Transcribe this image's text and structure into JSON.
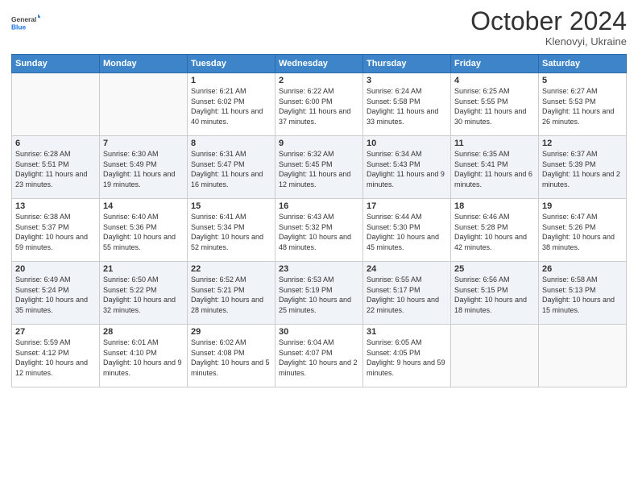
{
  "header": {
    "logo_general": "General",
    "logo_blue": "Blue",
    "month_title": "October 2024",
    "subtitle": "Klenovyi, Ukraine"
  },
  "columns": [
    "Sunday",
    "Monday",
    "Tuesday",
    "Wednesday",
    "Thursday",
    "Friday",
    "Saturday"
  ],
  "weeks": [
    [
      {
        "day": "",
        "info": ""
      },
      {
        "day": "",
        "info": ""
      },
      {
        "day": "1",
        "info": "Sunrise: 6:21 AM\nSunset: 6:02 PM\nDaylight: 11 hours and 40 minutes."
      },
      {
        "day": "2",
        "info": "Sunrise: 6:22 AM\nSunset: 6:00 PM\nDaylight: 11 hours and 37 minutes."
      },
      {
        "day": "3",
        "info": "Sunrise: 6:24 AM\nSunset: 5:58 PM\nDaylight: 11 hours and 33 minutes."
      },
      {
        "day": "4",
        "info": "Sunrise: 6:25 AM\nSunset: 5:55 PM\nDaylight: 11 hours and 30 minutes."
      },
      {
        "day": "5",
        "info": "Sunrise: 6:27 AM\nSunset: 5:53 PM\nDaylight: 11 hours and 26 minutes."
      }
    ],
    [
      {
        "day": "6",
        "info": "Sunrise: 6:28 AM\nSunset: 5:51 PM\nDaylight: 11 hours and 23 minutes."
      },
      {
        "day": "7",
        "info": "Sunrise: 6:30 AM\nSunset: 5:49 PM\nDaylight: 11 hours and 19 minutes."
      },
      {
        "day": "8",
        "info": "Sunrise: 6:31 AM\nSunset: 5:47 PM\nDaylight: 11 hours and 16 minutes."
      },
      {
        "day": "9",
        "info": "Sunrise: 6:32 AM\nSunset: 5:45 PM\nDaylight: 11 hours and 12 minutes."
      },
      {
        "day": "10",
        "info": "Sunrise: 6:34 AM\nSunset: 5:43 PM\nDaylight: 11 hours and 9 minutes."
      },
      {
        "day": "11",
        "info": "Sunrise: 6:35 AM\nSunset: 5:41 PM\nDaylight: 11 hours and 6 minutes."
      },
      {
        "day": "12",
        "info": "Sunrise: 6:37 AM\nSunset: 5:39 PM\nDaylight: 11 hours and 2 minutes."
      }
    ],
    [
      {
        "day": "13",
        "info": "Sunrise: 6:38 AM\nSunset: 5:37 PM\nDaylight: 10 hours and 59 minutes."
      },
      {
        "day": "14",
        "info": "Sunrise: 6:40 AM\nSunset: 5:36 PM\nDaylight: 10 hours and 55 minutes."
      },
      {
        "day": "15",
        "info": "Sunrise: 6:41 AM\nSunset: 5:34 PM\nDaylight: 10 hours and 52 minutes."
      },
      {
        "day": "16",
        "info": "Sunrise: 6:43 AM\nSunset: 5:32 PM\nDaylight: 10 hours and 48 minutes."
      },
      {
        "day": "17",
        "info": "Sunrise: 6:44 AM\nSunset: 5:30 PM\nDaylight: 10 hours and 45 minutes."
      },
      {
        "day": "18",
        "info": "Sunrise: 6:46 AM\nSunset: 5:28 PM\nDaylight: 10 hours and 42 minutes."
      },
      {
        "day": "19",
        "info": "Sunrise: 6:47 AM\nSunset: 5:26 PM\nDaylight: 10 hours and 38 minutes."
      }
    ],
    [
      {
        "day": "20",
        "info": "Sunrise: 6:49 AM\nSunset: 5:24 PM\nDaylight: 10 hours and 35 minutes."
      },
      {
        "day": "21",
        "info": "Sunrise: 6:50 AM\nSunset: 5:22 PM\nDaylight: 10 hours and 32 minutes."
      },
      {
        "day": "22",
        "info": "Sunrise: 6:52 AM\nSunset: 5:21 PM\nDaylight: 10 hours and 28 minutes."
      },
      {
        "day": "23",
        "info": "Sunrise: 6:53 AM\nSunset: 5:19 PM\nDaylight: 10 hours and 25 minutes."
      },
      {
        "day": "24",
        "info": "Sunrise: 6:55 AM\nSunset: 5:17 PM\nDaylight: 10 hours and 22 minutes."
      },
      {
        "day": "25",
        "info": "Sunrise: 6:56 AM\nSunset: 5:15 PM\nDaylight: 10 hours and 18 minutes."
      },
      {
        "day": "26",
        "info": "Sunrise: 6:58 AM\nSunset: 5:13 PM\nDaylight: 10 hours and 15 minutes."
      }
    ],
    [
      {
        "day": "27",
        "info": "Sunrise: 5:59 AM\nSunset: 4:12 PM\nDaylight: 10 hours and 12 minutes."
      },
      {
        "day": "28",
        "info": "Sunrise: 6:01 AM\nSunset: 4:10 PM\nDaylight: 10 hours and 9 minutes."
      },
      {
        "day": "29",
        "info": "Sunrise: 6:02 AM\nSunset: 4:08 PM\nDaylight: 10 hours and 5 minutes."
      },
      {
        "day": "30",
        "info": "Sunrise: 6:04 AM\nSunset: 4:07 PM\nDaylight: 10 hours and 2 minutes."
      },
      {
        "day": "31",
        "info": "Sunrise: 6:05 AM\nSunset: 4:05 PM\nDaylight: 9 hours and 59 minutes."
      },
      {
        "day": "",
        "info": ""
      },
      {
        "day": "",
        "info": ""
      }
    ]
  ]
}
